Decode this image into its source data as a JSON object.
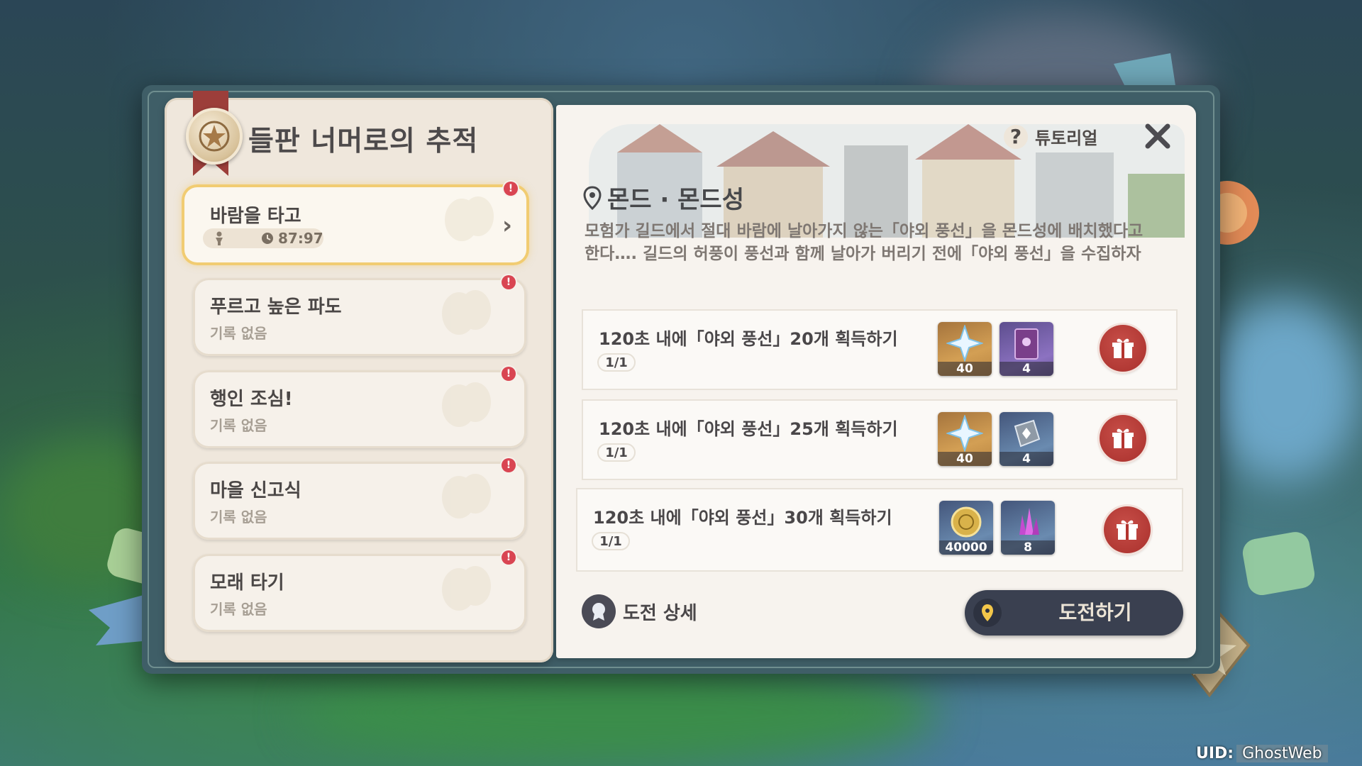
{
  "event": {
    "title": "들판 너머로의 추적"
  },
  "challenges": [
    {
      "name": "바람을 타고",
      "time": "87:97",
      "active": true
    },
    {
      "name": "푸르고 높은 파도",
      "status": "기록 없음"
    },
    {
      "name": "행인 조심!",
      "status": "기록 없음"
    },
    {
      "name": "마을 신고식",
      "status": "기록 없음"
    },
    {
      "name": "모래 타기",
      "status": "기록 없음"
    }
  ],
  "header": {
    "tutorial_label": "튜토리얼",
    "tutorial_icon": "question-icon",
    "close_icon": "close-icon"
  },
  "detail": {
    "location": "몬드 · 몬드성",
    "description": "모험가 길드에서 절대 바람에 날아가지 않는「야외 풍선」을 몬드성에 배치했다고 한다…. 길드의 허풍이 풍선과 함께 날아가 버리기 전에「야외 풍선」을 수집하자"
  },
  "goals": [
    {
      "text": "120초 내에「야외 풍선」20개 획득하기",
      "progress": "1/1",
      "rewards": [
        {
          "icon": "primogem-icon",
          "qty": "40"
        },
        {
          "icon": "heros-wit-book-icon",
          "qty": "4"
        }
      ]
    },
    {
      "text": "120초 내에「야외 풍선」25개 획득하기",
      "progress": "1/1",
      "rewards": [
        {
          "icon": "primogem-icon",
          "qty": "40"
        },
        {
          "icon": "mystic-ore-icon",
          "qty": "4"
        }
      ]
    },
    {
      "text": "120초 내에「야외 풍선」30개 획득하기",
      "progress": "1/1",
      "rewards": [
        {
          "icon": "mora-coin-icon",
          "qty": "40000"
        },
        {
          "icon": "crystal-icon",
          "qty": "8"
        }
      ]
    }
  ],
  "footer": {
    "detail_label": "도전 상세",
    "start_label": "도전하기"
  },
  "uid": {
    "label": "UID:",
    "value": "GhostWeb"
  },
  "colors": {
    "alert": "#d94552",
    "claim": "#b3342f",
    "active_border": "#f1cc72",
    "start_button": "#3a4050"
  }
}
